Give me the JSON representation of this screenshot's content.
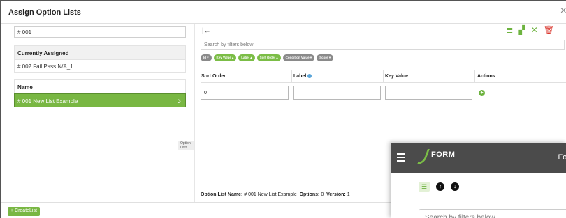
{
  "dialog": {
    "title": "Assign Option Lists",
    "close_icon": "close-icon",
    "close_glyph": "×"
  },
  "left_panel": {
    "search_value": "# 001",
    "currently_assigned_header": "Currently Assigned",
    "currently_assigned_items": [
      "# 002 Fail Pass N/A_1"
    ],
    "name_header": "Name",
    "name_items": [
      {
        "label": "# 001 New List Example",
        "selected": true
      }
    ],
    "tooltip_tag": "Option Lists",
    "chevron_glyph": "›"
  },
  "right_panel": {
    "collapse_glyph": "|←",
    "toolbar_glyphs": {
      "copy": "≣",
      "save": "▞",
      "remove": "✕",
      "delete": "🗑"
    },
    "search_placeholder": "Search by filters below",
    "filter_chips": [
      {
        "label": "Id ▾",
        "color": "#8a8a8a"
      },
      {
        "label": "Key Value ▴",
        "color": "#7bbd46"
      },
      {
        "label": "Label ▴",
        "color": "#7bbd46"
      },
      {
        "label": "Sort Order ▴",
        "color": "#7bbd46"
      },
      {
        "label": "Condition Value ▾",
        "color": "#8a8a8a"
      },
      {
        "label": "Score ▾",
        "color": "#8a8a8a"
      }
    ],
    "columns": {
      "sort_order": "Sort Order",
      "label": "Label",
      "key_value": "Key Value",
      "actions": "Actions"
    },
    "row": {
      "sort_order": "0",
      "label": "",
      "key_value": "",
      "add_glyph": "+"
    },
    "footer": {
      "name_label": "Option List Name:",
      "name_value": "# 001 New List Example",
      "options_label": "Options:",
      "options_value": "0",
      "version_label": "Version:",
      "version_value": "1"
    }
  },
  "bottom_bar": {
    "create_button": "+ CreateList"
  },
  "overlay_window": {
    "logo_text": "FORM",
    "right_text": "For",
    "list_glyph": "☰",
    "up_glyph": "↑",
    "down_glyph": "↓",
    "search_placeholder": "Search by filters below"
  },
  "colors": {
    "accent_green": "#79b743",
    "danger_red": "#d9342b",
    "overlay_bar": "#4b4b4b"
  }
}
